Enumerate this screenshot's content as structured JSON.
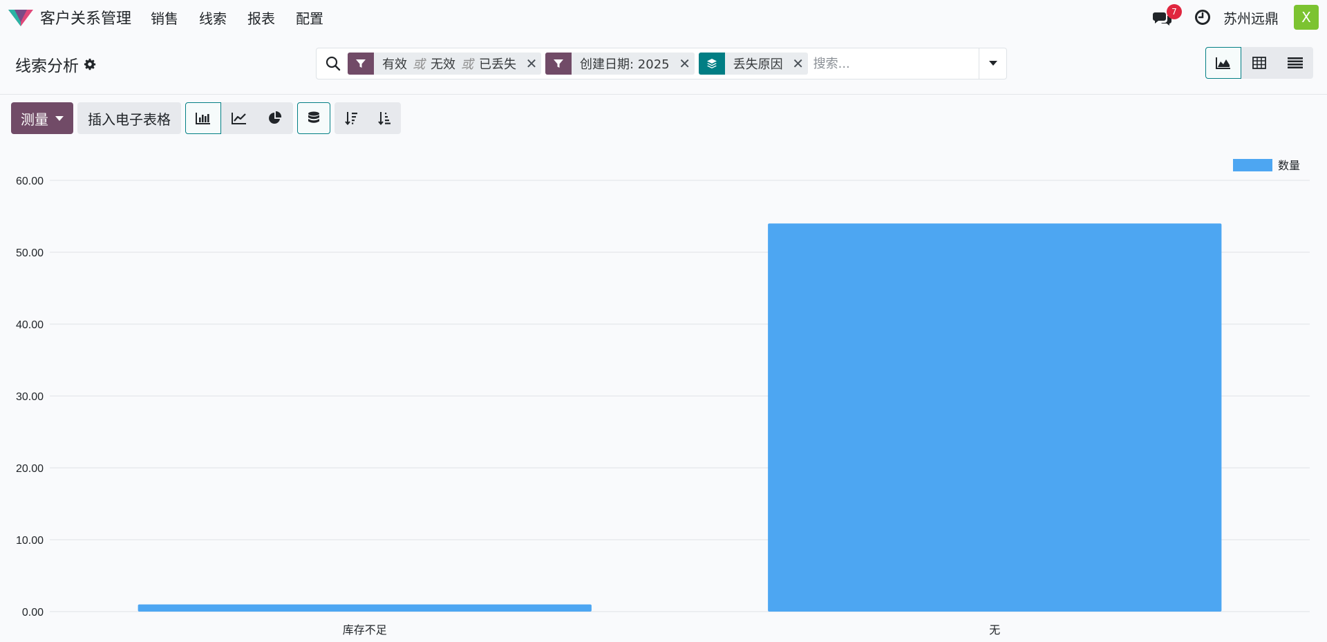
{
  "navbar": {
    "app_title": "客户关系管理",
    "menu": [
      "销售",
      "线索",
      "报表",
      "配置"
    ],
    "message_count": "7",
    "company": "苏州远鼎",
    "avatar_letter": "X"
  },
  "control_panel": {
    "page_title": "线索分析",
    "facets": [
      {
        "type": "filter",
        "values": [
          "有效",
          "无效",
          "已丢失"
        ],
        "separator": "或"
      },
      {
        "type": "filter",
        "values": [
          "创建日期: 2025"
        ],
        "separator": "或"
      },
      {
        "type": "group",
        "values": [
          "丢失原因"
        ],
        "separator": "或"
      }
    ],
    "search_placeholder": "搜索..."
  },
  "toolbar": {
    "measure_label": "测量",
    "insert_sheet_label": "插入电子表格"
  },
  "colors": {
    "primary": "#714b67",
    "teal": "#017e84",
    "bar": "#4da6f2",
    "badge": "#e0263f"
  },
  "chart_data": {
    "type": "bar",
    "categories": [
      "库存不足",
      "无"
    ],
    "series": [
      {
        "name": "数量",
        "values": [
          1,
          54
        ],
        "color": "#4da6f2"
      }
    ],
    "ylim": [
      0,
      60
    ],
    "yticks": [
      "0.00",
      "10.00",
      "20.00",
      "30.00",
      "40.00",
      "50.00",
      "60.00"
    ],
    "grid": true,
    "legend_position": "top-right"
  }
}
